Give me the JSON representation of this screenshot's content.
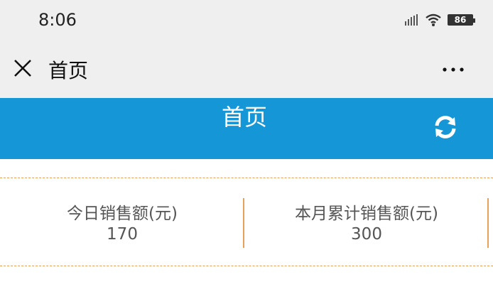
{
  "status_bar": {
    "time": "8:06",
    "battery": "86"
  },
  "nav": {
    "title": "首页",
    "close_icon": "close-icon",
    "more_icon": "more-horizontal-icon"
  },
  "header": {
    "title": "首页",
    "refresh_icon": "refresh-icon",
    "background_color": "#1596d6"
  },
  "stats": [
    {
      "label": "今日销售额(元)",
      "value": "170"
    },
    {
      "label": "本月累计销售额(元)",
      "value": "300"
    }
  ],
  "colors": {
    "accent_border": "#e8a15a"
  }
}
